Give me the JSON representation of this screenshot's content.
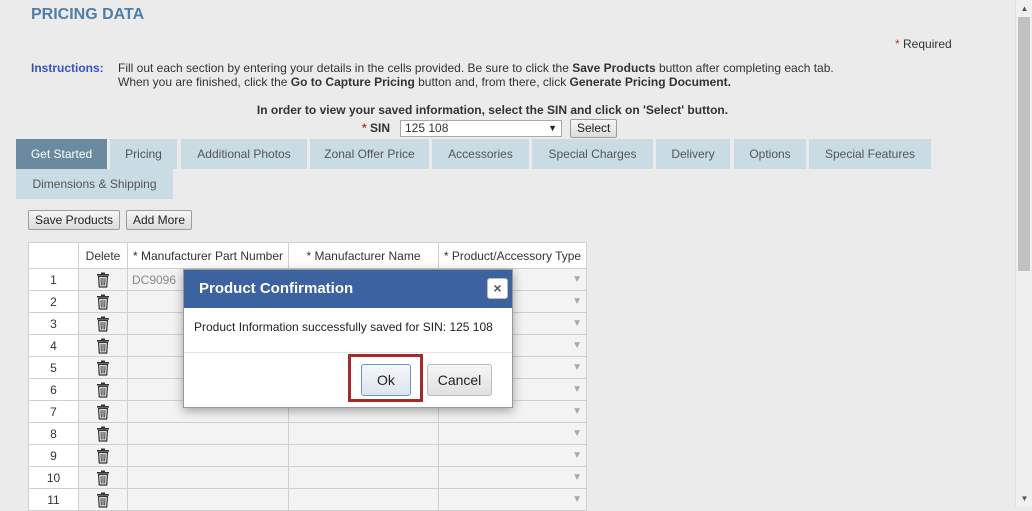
{
  "page": {
    "title": "PRICING DATA"
  },
  "required_note": {
    "star": "*",
    "text": "Required"
  },
  "instructions": {
    "label": "Instructions:",
    "line1_a": "Fill out each section by entering your details in the cells provided. Be sure to click the ",
    "line1_b": "Save Products",
    "line1_c": " button after completing each tab.",
    "line2_a": "When you are finished, click the ",
    "line2_b": "Go to Capture Pricing",
    "line2_c": " button and, from there, click ",
    "line2_d": "Generate Pricing Document."
  },
  "sin": {
    "prompt": "In order to view your saved information, select the SIN and click on 'Select' button.",
    "star": "*",
    "label": "SIN",
    "selected": "125 108",
    "select_button": "Select"
  },
  "tabs": [
    {
      "label": "Get Started",
      "active": true
    },
    {
      "label": "Pricing"
    },
    {
      "label": "Additional Photos"
    },
    {
      "label": "Zonal Offer Price"
    },
    {
      "label": "Accessories"
    },
    {
      "label": "Special Charges"
    },
    {
      "label": "Delivery"
    },
    {
      "label": "Options"
    },
    {
      "label": "Special Features"
    },
    {
      "label": "Dimensions & Shipping"
    }
  ],
  "toolbar": {
    "save_label": "Save Products",
    "add_more_label": "Add More"
  },
  "table": {
    "headers": [
      "",
      "Delete",
      "* Manufacturer Part Number",
      "* Manufacturer Name",
      "* Product/Accessory Type"
    ],
    "rows": [
      {
        "num": "1",
        "mpn": "DC9096"
      },
      {
        "num": "2",
        "mpn": ""
      },
      {
        "num": "3",
        "mpn": ""
      },
      {
        "num": "4",
        "mpn": ""
      },
      {
        "num": "5",
        "mpn": ""
      },
      {
        "num": "6",
        "mpn": ""
      },
      {
        "num": "7",
        "mpn": ""
      },
      {
        "num": "8",
        "mpn": ""
      },
      {
        "num": "9",
        "mpn": ""
      },
      {
        "num": "10",
        "mpn": ""
      },
      {
        "num": "11",
        "mpn": ""
      }
    ]
  },
  "modal": {
    "title": "Product Confirmation",
    "close": "×",
    "message": "Product Information successfully saved for SIN: 125 108",
    "ok_label": "Ok",
    "cancel_label": "Cancel"
  },
  "colors": {
    "title": "#4f7fa6",
    "active_tab": "#6b8aa0",
    "tab": "#c9dbe3",
    "modal_header": "#3d62a0",
    "highlight": "#a52a2a"
  }
}
